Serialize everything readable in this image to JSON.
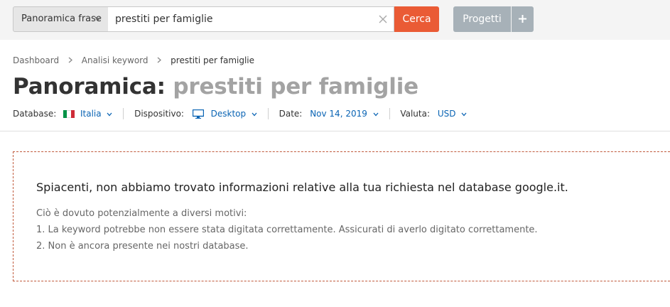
{
  "colors": {
    "accent": "#ea5b35",
    "link": "#0a64b4",
    "button_secondary": "#a7b1b8",
    "notice_border": "#c05a3c"
  },
  "search": {
    "type_label": "Panoramica frase",
    "query": "prestiti per famiglie",
    "submit_label": "Cerca"
  },
  "projects": {
    "label": "Progetti",
    "add_icon": "plus-icon"
  },
  "breadcrumb": {
    "items": [
      "Dashboard",
      "Analisi keyword",
      "prestiti per famiglie"
    ]
  },
  "title": {
    "main": "Panoramica:",
    "query": "prestiti per famiglie"
  },
  "filters": {
    "database_label": "Database:",
    "database_value": "Italia",
    "database_icon": "italy-flag-icon",
    "device_label": "Dispositivo:",
    "device_value": "Desktop",
    "device_icon": "desktop-monitor-icon",
    "date_label": "Date:",
    "date_value": "Nov 14, 2019",
    "currency_label": "Valuta:",
    "currency_value": "USD"
  },
  "notice": {
    "title": "Spiacenti, non abbiamo trovato informazioni relative alla tua richiesta nel database google.it.",
    "reason_intro": "Ciò è dovuto potenzialmente a diversi motivi:",
    "reasons": [
      "1. La keyword potrebbe non essere stata digitata correttamente. Assicurati di averlo digitato correttamente.",
      "2. Non è ancora presente nei nostri database."
    ]
  }
}
